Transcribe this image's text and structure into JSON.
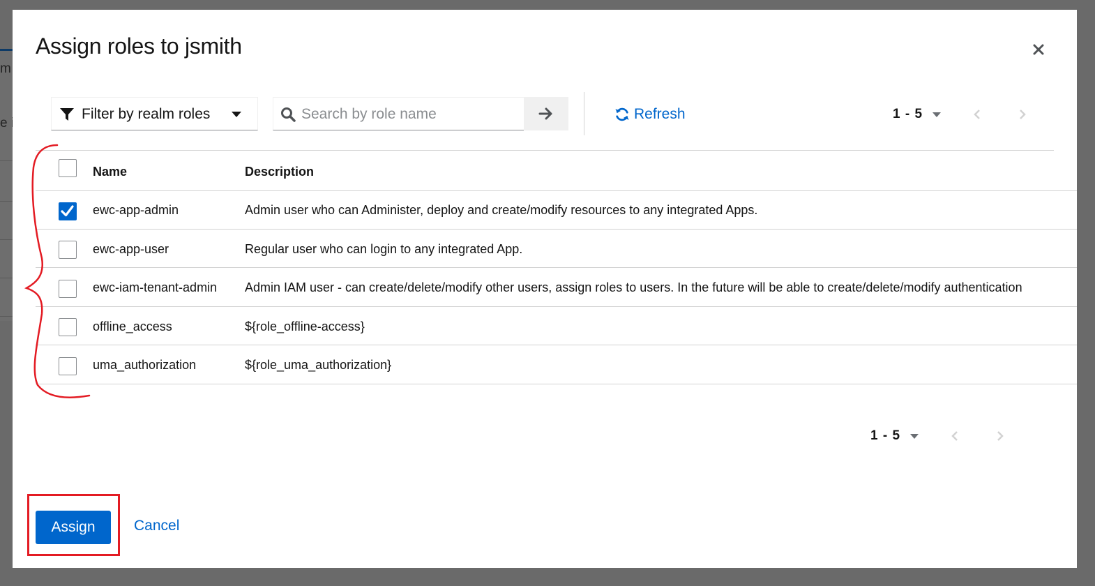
{
  "background": {
    "text_fragment_1": "m",
    "text_fragment_2": "e i"
  },
  "modal": {
    "title": "Assign roles to jsmith",
    "close_icon": "close-icon"
  },
  "toolbar": {
    "filter": {
      "icon": "filter-icon",
      "label": "Filter by realm roles",
      "caret_icon": "caret-down-icon"
    },
    "search": {
      "icon": "search-icon",
      "placeholder": "Search by role name",
      "value": "",
      "go_icon": "arrow-right-icon"
    },
    "refresh": {
      "icon": "refresh-icon",
      "label": "Refresh"
    },
    "pagination": {
      "range": "1 - 5"
    }
  },
  "table": {
    "columns": [
      "Name",
      "Description"
    ],
    "rows": [
      {
        "name": "ewc-app-admin",
        "description": "Admin user who can Administer, deploy and create/modify resources to any integrated Apps.",
        "checked": true
      },
      {
        "name": "ewc-app-user",
        "description": "Regular user who can login to any integrated App.",
        "checked": false
      },
      {
        "name": "ewc-iam-tenant-admin",
        "description": "Admin IAM user - can create/delete/modify other users, assign roles to users. In the future will be able to create/delete/modify authentication",
        "checked": false
      },
      {
        "name": "offline_access",
        "description": "${role_offline-access}",
        "checked": false
      },
      {
        "name": "uma_authorization",
        "description": "${role_uma_authorization}",
        "checked": false
      }
    ]
  },
  "footer": {
    "pagination": {
      "range": "1 - 5"
    },
    "assign_label": "Assign",
    "cancel_label": "Cancel"
  },
  "colors": {
    "primary": "#0066cc",
    "annotation": "#e31b23",
    "overlay": "#6a6a6a"
  }
}
